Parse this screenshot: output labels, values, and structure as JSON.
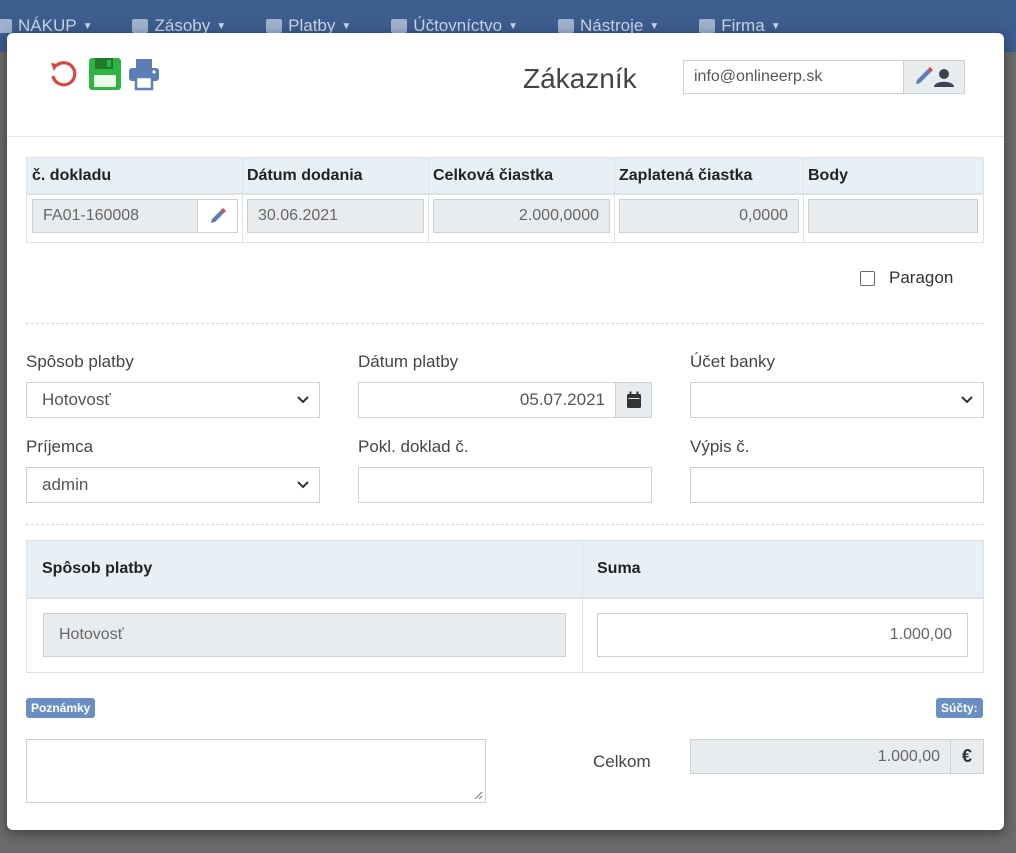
{
  "nav": {
    "items": [
      {
        "label": "NÁKUP",
        "icon": "list-icon"
      },
      {
        "label": "Zásoby",
        "icon": "box-icon"
      },
      {
        "label": "Platby",
        "icon": "money-icon"
      },
      {
        "label": "Účtovníctvo",
        "icon": "book-icon"
      },
      {
        "label": "Nástroje",
        "icon": "wrench-icon"
      },
      {
        "label": "Firma",
        "icon": "gear-icon"
      }
    ]
  },
  "modal": {
    "title": "Zákazník",
    "customer_email": "info@onlineerp.sk",
    "toolbar": {
      "undo_icon": "undo-icon",
      "save_icon": "save-icon",
      "print_icon": "print-icon"
    }
  },
  "invoice": {
    "headers": {
      "doc_no": "č. dokladu",
      "delivery_date": "Dátum dodania",
      "total_amount": "Celková čiastka",
      "paid_amount": "Zaplatená čiastka",
      "points": "Body"
    },
    "row": {
      "doc_no": "FA01-160008",
      "delivery_date": "30.06.2021",
      "total_amount": "2.000,0000",
      "paid_amount": "0,0000",
      "points": ""
    }
  },
  "paragon": {
    "label": "Paragon",
    "checked": false
  },
  "form": {
    "payment_method": {
      "label": "Spôsob platby",
      "value": "Hotovosť"
    },
    "payment_date": {
      "label": "Dátum platby",
      "value": "05.07.2021"
    },
    "bank_account": {
      "label": "Účet banky",
      "value": ""
    },
    "recipient": {
      "label": "Príjemca",
      "value": "admin"
    },
    "cash_doc_no": {
      "label": "Pokl. doklad č.",
      "value": ""
    },
    "statement_no": {
      "label": "Výpis č.",
      "value": ""
    }
  },
  "payments": {
    "headers": {
      "method": "Spôsob platby",
      "amount": "Suma"
    },
    "row": {
      "method": "Hotovosť",
      "amount": "1.000,00"
    }
  },
  "notes": {
    "badge": "Poznámky",
    "value": ""
  },
  "totals": {
    "badge": "Súčty:",
    "label": "Celkom",
    "value": "1.000,00",
    "currency": "€"
  }
}
